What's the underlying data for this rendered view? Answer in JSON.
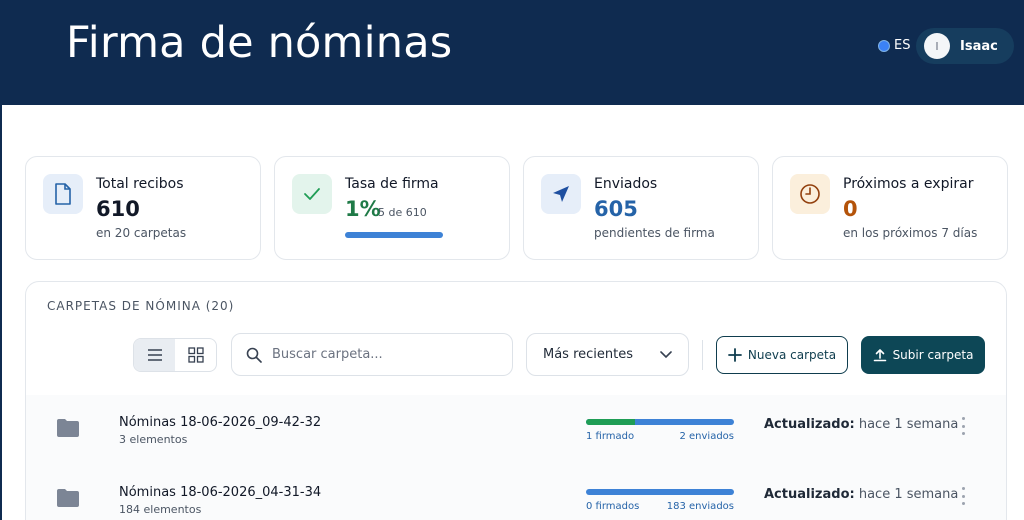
{
  "header": {
    "title": "Firma de nóminas",
    "language": "ES",
    "user": {
      "initial": "I",
      "name": "Isaac"
    }
  },
  "stats": [
    {
      "label": "Total recibos",
      "value": "610",
      "sub": "en 20 carpetas",
      "color": "#111827",
      "icon": "document-icon"
    },
    {
      "label": "Tasa de firma",
      "value": "1%",
      "detail": "5 de 610",
      "progress": 0.01,
      "color": "#1f9d55",
      "icon": "check-icon"
    },
    {
      "label": "Enviados",
      "value": "605",
      "sub": "pendientes de firma",
      "color": "#2563a8",
      "icon": "send-icon"
    },
    {
      "label": "Próximos a expirar",
      "value": "0",
      "sub": "en los próximos 7 días",
      "color": "#b45309",
      "icon": "clock-icon"
    }
  ],
  "folders_panel": {
    "title": "CARPETAS DE NÓMINA (20)",
    "search_placeholder": "Buscar carpeta...",
    "sort_label": "Más recientes",
    "new_folder_label": "Nueva carpeta",
    "upload_label": "Subir carpeta",
    "view_mode": "list",
    "rows": [
      {
        "name": "Nóminas 18-06-2026_09-42-32",
        "count": "3 elementos",
        "signed": "1 firmado",
        "sent": "2 enviados",
        "signed_fraction": 0.33,
        "updated_label": "Actualizado:",
        "updated_value": "hace 1 semana"
      },
      {
        "name": "Nóminas 18-06-2026_04-31-34",
        "count": "184 elementos",
        "signed": "0 firmados",
        "sent": "183 enviados",
        "signed_fraction": 0,
        "updated_label": "Actualizado:",
        "updated_value": "hace 1 semana"
      }
    ]
  },
  "colors": {
    "header_bg": "#0f2b50",
    "primary_button": "#0d4756",
    "progress_sent": "#3d82d6",
    "progress_signed": "#1f9d55"
  }
}
